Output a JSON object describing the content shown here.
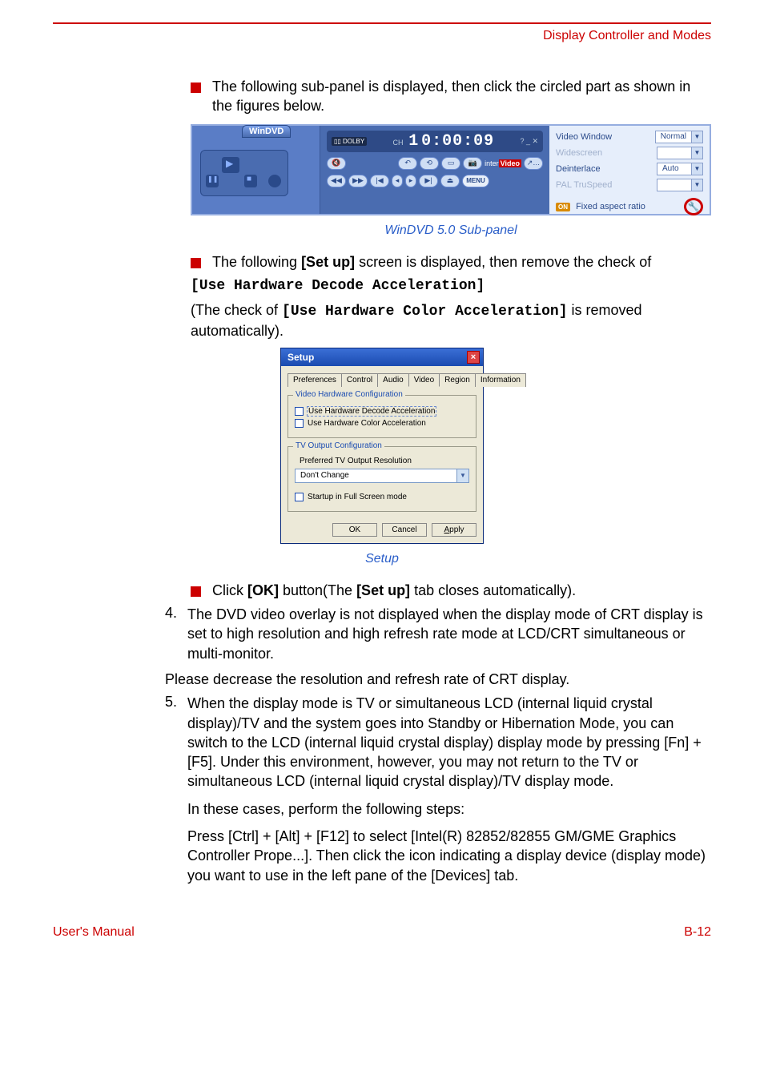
{
  "header": {
    "title": "Display Controller and Modes"
  },
  "body": {
    "bullet1_text": "The following sub-panel is displayed, then click the circled part as shown in the figures below.",
    "bullet2_prefix": "The following ",
    "bullet2_bold": "[Set up]",
    "bullet2_suffix": " screen is displayed, then remove the check of",
    "bullet2_code": "[Use Hardware Decode Acceleration]",
    "bullet2_para_prefix": "(The check of ",
    "bullet2_para_code": "[Use Hardware Color Acceleration]",
    "bullet2_para_suffix": " is removed automatically).",
    "caption1": "WinDVD 5.0 Sub-panel",
    "caption2": "Setup",
    "bullet3_prefix": "Click ",
    "bullet3_b1": "[OK]",
    "bullet3_mid": " button(The ",
    "bullet3_b2": "[Set up]",
    "bullet3_suffix": " tab closes automatically).",
    "item4_num": "4.",
    "item4_text": "The DVD video overlay is not displayed when the display mode of CRT display is set to high resolution and high refresh rate mode at LCD/CRT simultaneous or multi-monitor.",
    "item4_para2": "Please decrease the resolution and refresh rate of CRT display.",
    "item5_num": "5.",
    "item5_text": "When the display mode is TV or simultaneous LCD (internal liquid crystal display)/TV and the system goes into Standby or Hibernation Mode, you can switch to the LCD (internal liquid crystal display) display mode by pressing [Fn] + [F5]. Under this environment, however, you may not return to the TV or simultaneous LCD (internal liquid crystal display)/TV display mode.",
    "item5_p2": "In these cases, perform the following steps:",
    "item5_p3": "Press [Ctrl] + [Alt] + [F12] to select [Intel(R) 82852/82855 GM/GME Graphics Controller Prope...]. Then click the icon indicating a display device (display mode) you want to use in the left pane of the [Devices] tab."
  },
  "fig1": {
    "winDVD": "WinDVD",
    "dolby": "DOLBY",
    "ch_label": "CH",
    "ch_num": "1",
    "timecode": "0:00:09",
    "inter_plain": "inter",
    "inter_hot": "Video",
    "menu": "MENU",
    "videoWindow_label": "Video Window",
    "videoWindow_value": "Normal",
    "widescreen_label": "Widescreen",
    "deinterlace_label": "Deinterlace",
    "deinterlace_value": "Auto",
    "pal_label": "PAL TruSpeed",
    "on_badge": "ON",
    "fixed_aspect": "Fixed aspect ratio"
  },
  "fig2": {
    "title": "Setup",
    "close": "×",
    "tabs": {
      "preferences": "Preferences",
      "control": "Control",
      "audio": "Audio",
      "video": "Video",
      "region": "Region",
      "information": "Information"
    },
    "group1_title": "Video Hardware Configuration",
    "chk1": "Use Hardware Decode Acceleration",
    "chk2": "Use Hardware Color Acceleration",
    "group2_title": "TV Output Configuration",
    "tv_label": "Preferred TV Output Resolution",
    "tv_value": "Don't Change",
    "chk3": "Startup in Full Screen mode",
    "ok": "OK",
    "cancel": "Cancel",
    "apply": "Apply"
  },
  "footer": {
    "left": "User's Manual",
    "right": "B-12"
  }
}
